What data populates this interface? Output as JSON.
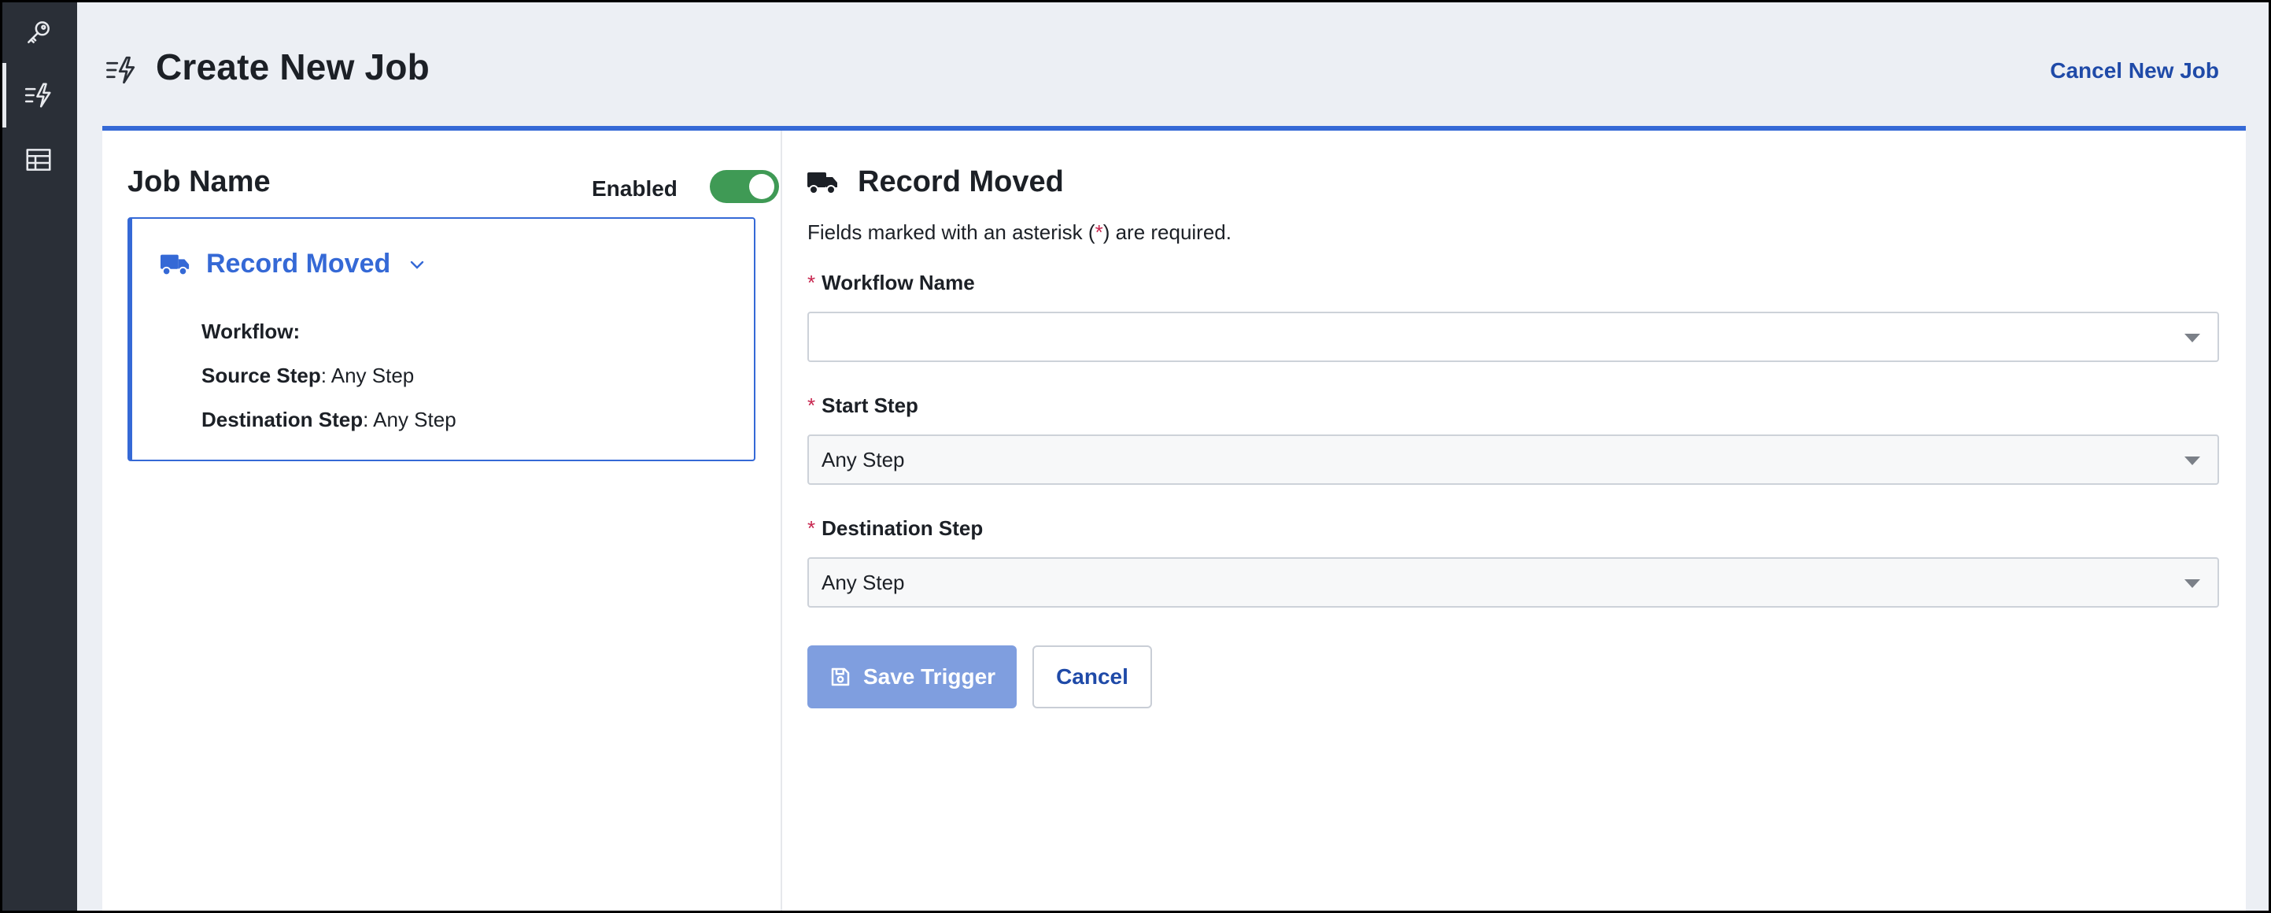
{
  "sidebar": {
    "items": [
      {
        "icon": "key-icon"
      },
      {
        "icon": "job-lightning-icon",
        "active": true
      },
      {
        "icon": "table-icon"
      }
    ]
  },
  "header": {
    "title": "Create New Job",
    "cancel_link": "Cancel New Job"
  },
  "left_panel": {
    "job_name": "Job Name",
    "enabled_label": "Enabled",
    "toggle_on": true,
    "trigger": {
      "title": "Record Moved",
      "workflow_label": "Workflow",
      "workflow_value": "",
      "source_label": "Source Step",
      "source_value": "Any Step",
      "destination_label": "Destination Step",
      "destination_value": "Any Step"
    }
  },
  "right_panel": {
    "title": "Record Moved",
    "note_before": "Fields marked with an asterisk (",
    "note_ast": "*",
    "note_after": ") are required.",
    "fields": [
      {
        "label": "Workflow Name",
        "value": ""
      },
      {
        "label": "Start Step",
        "value": "Any Step"
      },
      {
        "label": "Destination Step",
        "value": "Any Step"
      }
    ],
    "save_button": "Save Trigger",
    "cancel_button": "Cancel"
  },
  "colors": {
    "accent": "#3569d6",
    "toggle_on": "#3f9a55",
    "required": "#c7254e",
    "link": "#1f4aa8"
  }
}
